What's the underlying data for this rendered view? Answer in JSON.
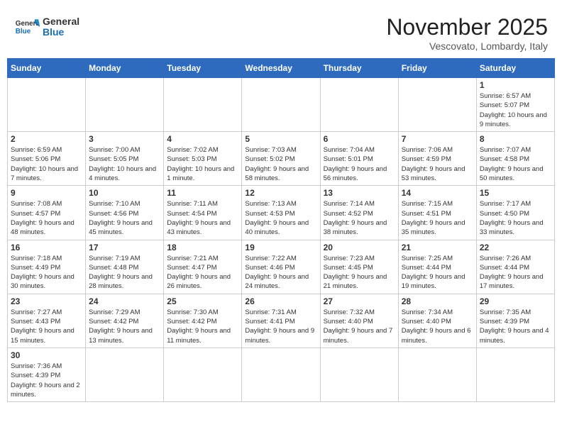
{
  "header": {
    "logo_general": "General",
    "logo_blue": "Blue",
    "month_year": "November 2025",
    "location": "Vescovato, Lombardy, Italy"
  },
  "weekdays": [
    "Sunday",
    "Monday",
    "Tuesday",
    "Wednesday",
    "Thursday",
    "Friday",
    "Saturday"
  ],
  "weeks": [
    [
      {
        "day": "",
        "info": ""
      },
      {
        "day": "",
        "info": ""
      },
      {
        "day": "",
        "info": ""
      },
      {
        "day": "",
        "info": ""
      },
      {
        "day": "",
        "info": ""
      },
      {
        "day": "",
        "info": ""
      },
      {
        "day": "1",
        "info": "Sunrise: 6:57 AM\nSunset: 5:07 PM\nDaylight: 10 hours and 9 minutes."
      }
    ],
    [
      {
        "day": "2",
        "info": "Sunrise: 6:59 AM\nSunset: 5:06 PM\nDaylight: 10 hours and 7 minutes."
      },
      {
        "day": "3",
        "info": "Sunrise: 7:00 AM\nSunset: 5:05 PM\nDaylight: 10 hours and 4 minutes."
      },
      {
        "day": "4",
        "info": "Sunrise: 7:02 AM\nSunset: 5:03 PM\nDaylight: 10 hours and 1 minute."
      },
      {
        "day": "5",
        "info": "Sunrise: 7:03 AM\nSunset: 5:02 PM\nDaylight: 9 hours and 58 minutes."
      },
      {
        "day": "6",
        "info": "Sunrise: 7:04 AM\nSunset: 5:01 PM\nDaylight: 9 hours and 56 minutes."
      },
      {
        "day": "7",
        "info": "Sunrise: 7:06 AM\nSunset: 4:59 PM\nDaylight: 9 hours and 53 minutes."
      },
      {
        "day": "8",
        "info": "Sunrise: 7:07 AM\nSunset: 4:58 PM\nDaylight: 9 hours and 50 minutes."
      }
    ],
    [
      {
        "day": "9",
        "info": "Sunrise: 7:08 AM\nSunset: 4:57 PM\nDaylight: 9 hours and 48 minutes."
      },
      {
        "day": "10",
        "info": "Sunrise: 7:10 AM\nSunset: 4:56 PM\nDaylight: 9 hours and 45 minutes."
      },
      {
        "day": "11",
        "info": "Sunrise: 7:11 AM\nSunset: 4:54 PM\nDaylight: 9 hours and 43 minutes."
      },
      {
        "day": "12",
        "info": "Sunrise: 7:13 AM\nSunset: 4:53 PM\nDaylight: 9 hours and 40 minutes."
      },
      {
        "day": "13",
        "info": "Sunrise: 7:14 AM\nSunset: 4:52 PM\nDaylight: 9 hours and 38 minutes."
      },
      {
        "day": "14",
        "info": "Sunrise: 7:15 AM\nSunset: 4:51 PM\nDaylight: 9 hours and 35 minutes."
      },
      {
        "day": "15",
        "info": "Sunrise: 7:17 AM\nSunset: 4:50 PM\nDaylight: 9 hours and 33 minutes."
      }
    ],
    [
      {
        "day": "16",
        "info": "Sunrise: 7:18 AM\nSunset: 4:49 PM\nDaylight: 9 hours and 30 minutes."
      },
      {
        "day": "17",
        "info": "Sunrise: 7:19 AM\nSunset: 4:48 PM\nDaylight: 9 hours and 28 minutes."
      },
      {
        "day": "18",
        "info": "Sunrise: 7:21 AM\nSunset: 4:47 PM\nDaylight: 9 hours and 26 minutes."
      },
      {
        "day": "19",
        "info": "Sunrise: 7:22 AM\nSunset: 4:46 PM\nDaylight: 9 hours and 24 minutes."
      },
      {
        "day": "20",
        "info": "Sunrise: 7:23 AM\nSunset: 4:45 PM\nDaylight: 9 hours and 21 minutes."
      },
      {
        "day": "21",
        "info": "Sunrise: 7:25 AM\nSunset: 4:44 PM\nDaylight: 9 hours and 19 minutes."
      },
      {
        "day": "22",
        "info": "Sunrise: 7:26 AM\nSunset: 4:44 PM\nDaylight: 9 hours and 17 minutes."
      }
    ],
    [
      {
        "day": "23",
        "info": "Sunrise: 7:27 AM\nSunset: 4:43 PM\nDaylight: 9 hours and 15 minutes."
      },
      {
        "day": "24",
        "info": "Sunrise: 7:29 AM\nSunset: 4:42 PM\nDaylight: 9 hours and 13 minutes."
      },
      {
        "day": "25",
        "info": "Sunrise: 7:30 AM\nSunset: 4:42 PM\nDaylight: 9 hours and 11 minutes."
      },
      {
        "day": "26",
        "info": "Sunrise: 7:31 AM\nSunset: 4:41 PM\nDaylight: 9 hours and 9 minutes."
      },
      {
        "day": "27",
        "info": "Sunrise: 7:32 AM\nSunset: 4:40 PM\nDaylight: 9 hours and 7 minutes."
      },
      {
        "day": "28",
        "info": "Sunrise: 7:34 AM\nSunset: 4:40 PM\nDaylight: 9 hours and 6 minutes."
      },
      {
        "day": "29",
        "info": "Sunrise: 7:35 AM\nSunset: 4:39 PM\nDaylight: 9 hours and 4 minutes."
      }
    ],
    [
      {
        "day": "30",
        "info": "Sunrise: 7:36 AM\nSunset: 4:39 PM\nDaylight: 9 hours and 2 minutes."
      },
      {
        "day": "",
        "info": ""
      },
      {
        "day": "",
        "info": ""
      },
      {
        "day": "",
        "info": ""
      },
      {
        "day": "",
        "info": ""
      },
      {
        "day": "",
        "info": ""
      },
      {
        "day": "",
        "info": ""
      }
    ]
  ]
}
